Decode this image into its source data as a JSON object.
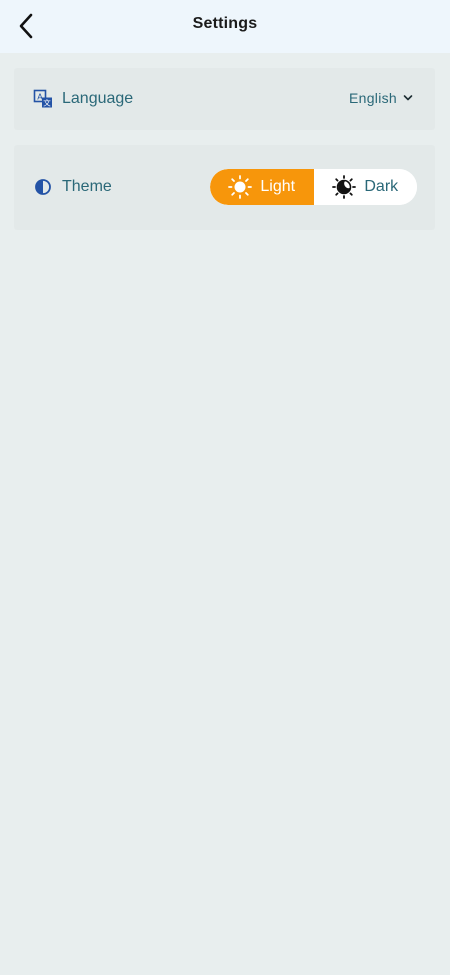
{
  "header": {
    "title": "Settings",
    "back_icon": "chevron-left-icon"
  },
  "settings": {
    "language": {
      "label": "Language",
      "icon": "translate-icon",
      "value": "English",
      "dropdown_icon": "chevron-down-icon"
    },
    "theme": {
      "label": "Theme",
      "icon": "contrast-icon",
      "options": [
        {
          "label": "Light",
          "icon": "sun-icon",
          "selected": true
        },
        {
          "label": "Dark",
          "icon": "moon-icon",
          "selected": false
        }
      ]
    }
  },
  "colors": {
    "accent": "#f7960b",
    "text_teal": "#2a6878",
    "icon_blue": "#2453a6",
    "header_bg": "#eef6fc",
    "page_bg": "#e8eeee",
    "card_bg": "#e3e9e9"
  }
}
